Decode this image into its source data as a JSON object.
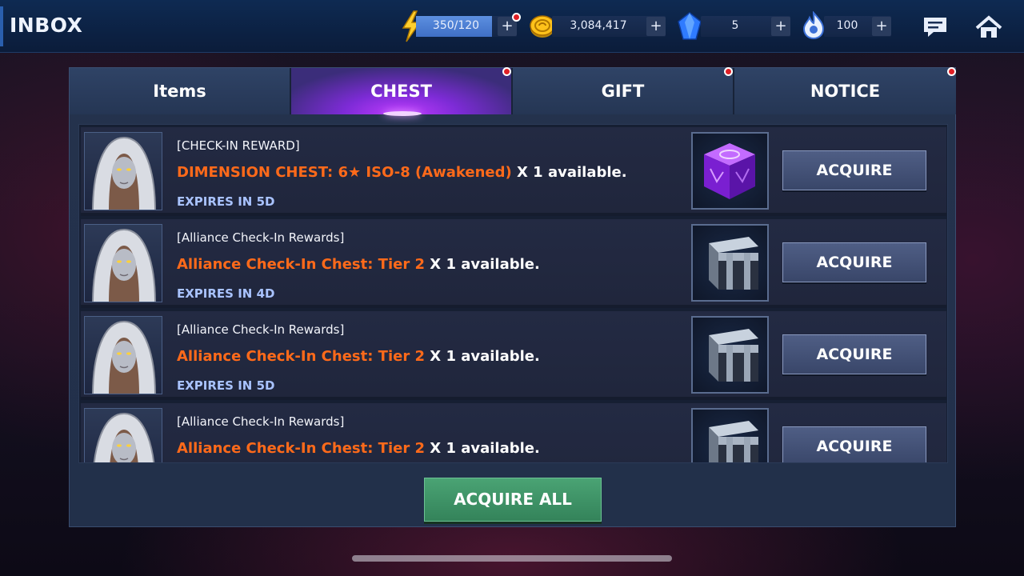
{
  "header": {
    "title": "INBOX",
    "resources": [
      {
        "name": "energy",
        "icon": "lightning-icon",
        "value": "350/120",
        "fill_ratio": 1.0,
        "has_notification": true
      },
      {
        "name": "gold",
        "icon": "gold-coin-icon",
        "value": "3,084,417"
      },
      {
        "name": "crystal",
        "icon": "blue-crystal-icon",
        "value": "5"
      },
      {
        "name": "flame",
        "icon": "blue-flame-icon",
        "value": "100"
      }
    ],
    "plus_label": "+",
    "buttons": [
      {
        "name": "chat",
        "icon": "chat-icon"
      },
      {
        "name": "home",
        "icon": "home-icon"
      }
    ]
  },
  "tabs": [
    {
      "label": "Items",
      "active": false,
      "notification": false
    },
    {
      "label": "CHEST",
      "active": true,
      "notification": true
    },
    {
      "label": "GIFT",
      "active": false,
      "notification": true
    },
    {
      "label": "NOTICE",
      "active": false,
      "notification": true
    }
  ],
  "rows": [
    {
      "title": "[CHECK-IN REWARD]",
      "item": "DIMENSION CHEST: 6★ ISO-8 (Awakened)",
      "qty": "X 1 available.",
      "expires": "EXPIRES IN 5D",
      "chest_icon": "purple-cube-chest-icon",
      "button": "ACQUIRE"
    },
    {
      "title": "[Alliance Check-In Rewards]",
      "item": "Alliance Check-In Chest: Tier 2",
      "qty": "X 1 available.",
      "expires": "EXPIRES IN 4D",
      "chest_icon": "metal-chest-icon",
      "button": "ACQUIRE"
    },
    {
      "title": "[Alliance Check-In Rewards]",
      "item": "Alliance Check-In Chest: Tier 2",
      "qty": "X 1 available.",
      "expires": "EXPIRES IN 5D",
      "chest_icon": "metal-chest-icon",
      "button": "ACQUIRE"
    },
    {
      "title": "[Alliance Check-In Rewards]",
      "item": "Alliance Check-In Chest: Tier 2",
      "qty": "X 1 available.",
      "expires": "",
      "chest_icon": "metal-chest-icon",
      "button": "ACQUIRE"
    }
  ],
  "acquire_all_label": "ACQUIRE ALL",
  "colors": {
    "item_text": "#ff6a1a",
    "expires_text": "#a9c3ff",
    "active_tab": "#8a2ff0",
    "acquire_all": "#3e9468"
  }
}
